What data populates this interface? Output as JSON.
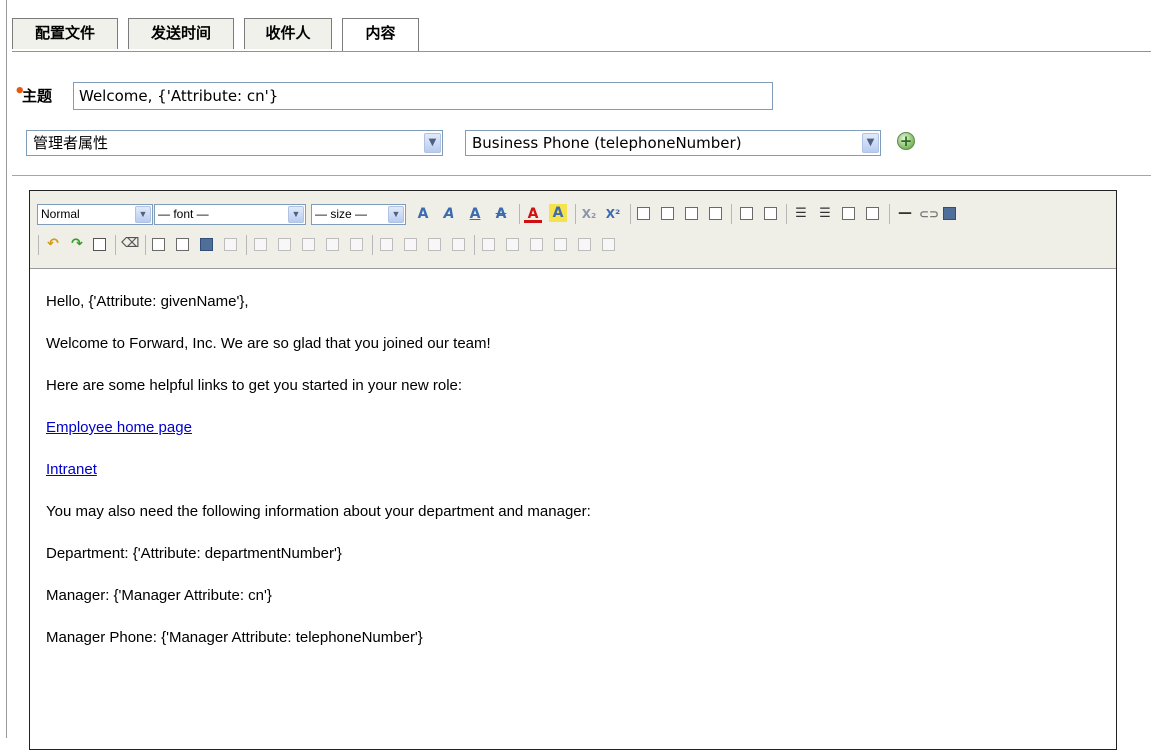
{
  "tabs": [
    {
      "label": "配置文件",
      "active": false
    },
    {
      "label": "发送时间",
      "active": false
    },
    {
      "label": "收件人",
      "active": false
    },
    {
      "label": "内容",
      "active": true
    }
  ],
  "subject": {
    "label": "主题",
    "required": true,
    "value": "Welcome, {'Attribute: cn'}"
  },
  "attribute_selector": {
    "category_value": "管理者属性",
    "attribute_value": "Business Phone (telephoneNumber)"
  },
  "toolbar": {
    "format_value": "Normal",
    "font_value": "— font —",
    "size_value": "— size —",
    "icons_row1": [
      "bold-icon",
      "italic-icon",
      "underline-icon",
      "strikethrough-icon",
      "font-color-icon",
      "highlight-color-icon",
      "subscript-icon",
      "superscript-icon",
      "align-left-icon",
      "align-center-icon",
      "align-right-icon",
      "justify-icon",
      "outdent-icon",
      "indent-icon",
      "ordered-list-icon",
      "unordered-list-icon",
      "decrease-indent-icon",
      "increase-indent-icon",
      "horizontal-rule-icon",
      "link-icon",
      "image-icon"
    ],
    "icons_row2": [
      "undo-icon",
      "redo-icon",
      "paste-word-icon",
      "eraser-icon",
      "source-icon",
      "table-icon",
      "table-props-icon",
      "cell-props-icon"
    ]
  },
  "body": {
    "greeting": "Hello, {'Attribute: givenName'},",
    "welcome": "Welcome to Forward, Inc. We are so glad that you joined our team!",
    "links_intro": "Here are some helpful links to get you started in your new role:",
    "link1": "Employee home page",
    "link2": "Intranet",
    "info_intro": "You may also need the following information about your department and manager:",
    "department": "Department: {'Attribute: departmentNumber'}",
    "manager": "Manager: {'Manager Attribute: cn'}",
    "manager_phone": "Manager Phone: {'Manager Attribute: telephoneNumber'}"
  },
  "colors": {
    "link": "#0000cc",
    "required_dot": "#e8580d",
    "toolbar_bg": "#f0efe7"
  }
}
